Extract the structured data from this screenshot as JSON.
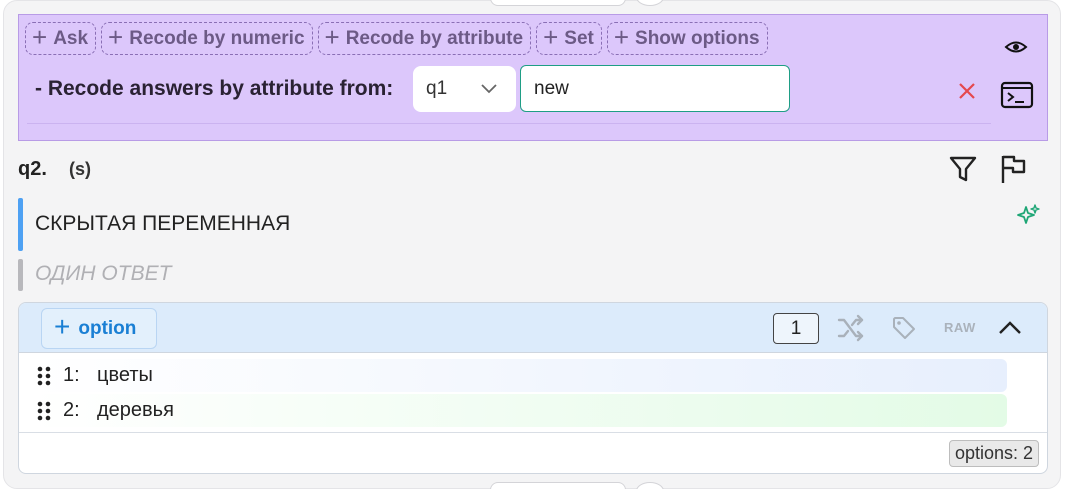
{
  "action_chips": [
    {
      "label": "Ask"
    },
    {
      "label": "Recode by numeric"
    },
    {
      "label": "Recode by attribute"
    },
    {
      "label": "Set"
    },
    {
      "label": "Show options"
    }
  ],
  "recode": {
    "label": "- Recode answers by attribute from:",
    "select_value": "q1",
    "input_value": "new"
  },
  "question": {
    "id_label": "q2.",
    "type_label": "(s)",
    "title": "СКРЫТАЯ ПЕРЕМЕННАЯ",
    "subtitle": "ОДИН ОТВЕТ"
  },
  "options_panel": {
    "add_label": "option",
    "count_value": "1",
    "raw_label": "RAW",
    "items": [
      {
        "num": "1:",
        "text": "цветы"
      },
      {
        "num": "2:",
        "text": "деревья"
      }
    ],
    "footer_badge": "options: 2"
  },
  "icons": {
    "eye": "eye-icon",
    "terminal": "terminal-icon",
    "close": "close-icon",
    "filter": "filter-icon",
    "flag": "flag-icon",
    "sparkle": "sparkle-icon",
    "shuffle": "shuffle-icon",
    "tag": "tag-icon",
    "collapse": "chevron-up-icon",
    "drag": "drag-handle-icon"
  },
  "colors": {
    "action_bg": "#dcc7fb",
    "accent_blue": "#1a7fd4",
    "close_red": "#e5484d",
    "input_border": "#1f9e85",
    "sparkle_green": "#1fa676"
  }
}
